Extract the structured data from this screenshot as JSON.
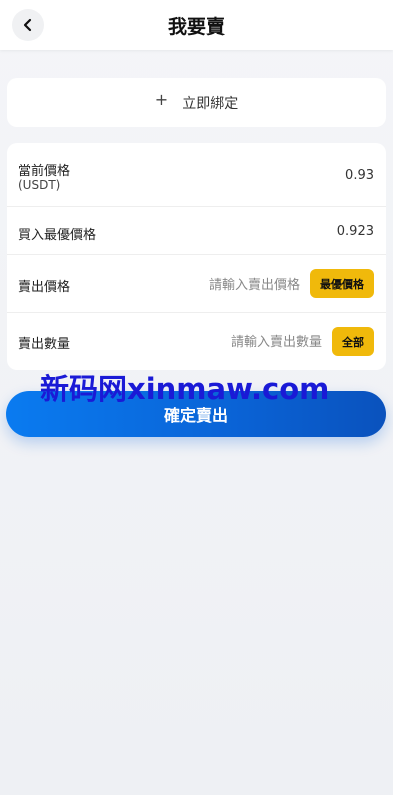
{
  "header": {
    "title": "我要賣",
    "back_icon": "chevron-left-icon"
  },
  "bind": {
    "icon": "plus-icon",
    "label": "立即綁定"
  },
  "rows": {
    "current_price": {
      "label": "當前價格",
      "unit": "(USDT)",
      "value": "0.93"
    },
    "best_buy": {
      "label": "買入最優價格",
      "value": "0.923"
    },
    "sell_price": {
      "label": "賣出價格",
      "placeholder": "請輸入賣出價格",
      "button": "最優價格"
    },
    "sell_qty": {
      "label": "賣出數量",
      "placeholder": "請輸入賣出數量",
      "button": "全部"
    }
  },
  "watermark": "新码网xinmaw.com",
  "confirm": {
    "label": "確定賣出"
  },
  "colors": {
    "accent_yellow": "#f0b90b",
    "button_blue": "#0a63d6"
  }
}
